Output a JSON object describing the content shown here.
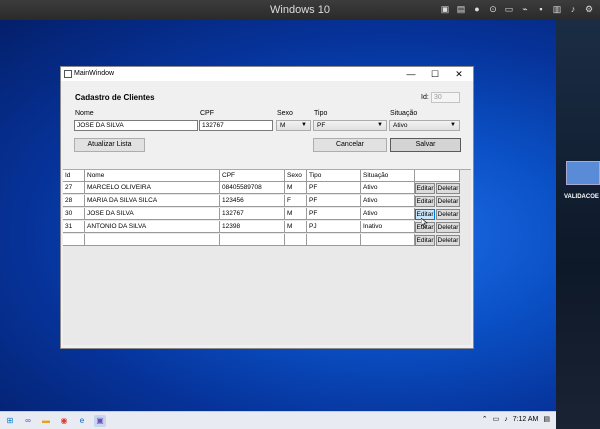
{
  "host": {
    "title": "Windows 10"
  },
  "window": {
    "title": "MainWindow",
    "min": "—",
    "max": "☐",
    "close": "✕"
  },
  "form": {
    "heading": "Cadastro de Clientes",
    "id_label": "Id:",
    "id_value": "30",
    "labels": {
      "nome": "Nome",
      "cpf": "CPF",
      "sexo": "Sexo",
      "tipo": "Tipo",
      "situacao": "Situação"
    },
    "values": {
      "nome": "JOSE DA SILVA",
      "cpf": "132767",
      "sexo": "M",
      "tipo": "PF",
      "situacao": "Ativo"
    },
    "buttons": {
      "atualizar": "Atualizar Lista",
      "cancelar": "Cancelar",
      "salvar": "Salvar"
    }
  },
  "grid": {
    "headers": [
      "Id",
      "Nome",
      "CPF",
      "Sexo",
      "Tipo",
      "Situação"
    ],
    "rows": [
      [
        "27",
        "MARCELO OLIVEIRA",
        "08405589708",
        "M",
        "PF",
        "Ativo"
      ],
      [
        "28",
        "MARIA DA SILVA SILCA",
        "123456",
        "F",
        "PF",
        "Ativo"
      ],
      [
        "30",
        "JOSE DA SILVA",
        "132767",
        "M",
        "PF",
        "Ativo"
      ],
      [
        "31",
        "ANTONIO DA SILVA",
        "12398",
        "M",
        "PJ",
        "Inativo"
      ],
      [
        "",
        "",
        "",
        "",
        "",
        ""
      ]
    ],
    "edit_label": "Editar",
    "delete_label": "Deletar"
  },
  "taskbar": {
    "time": "7:12 AM"
  },
  "side": {
    "label": "VALIDACOE"
  },
  "colors": {
    "accent": "#0078d7"
  }
}
